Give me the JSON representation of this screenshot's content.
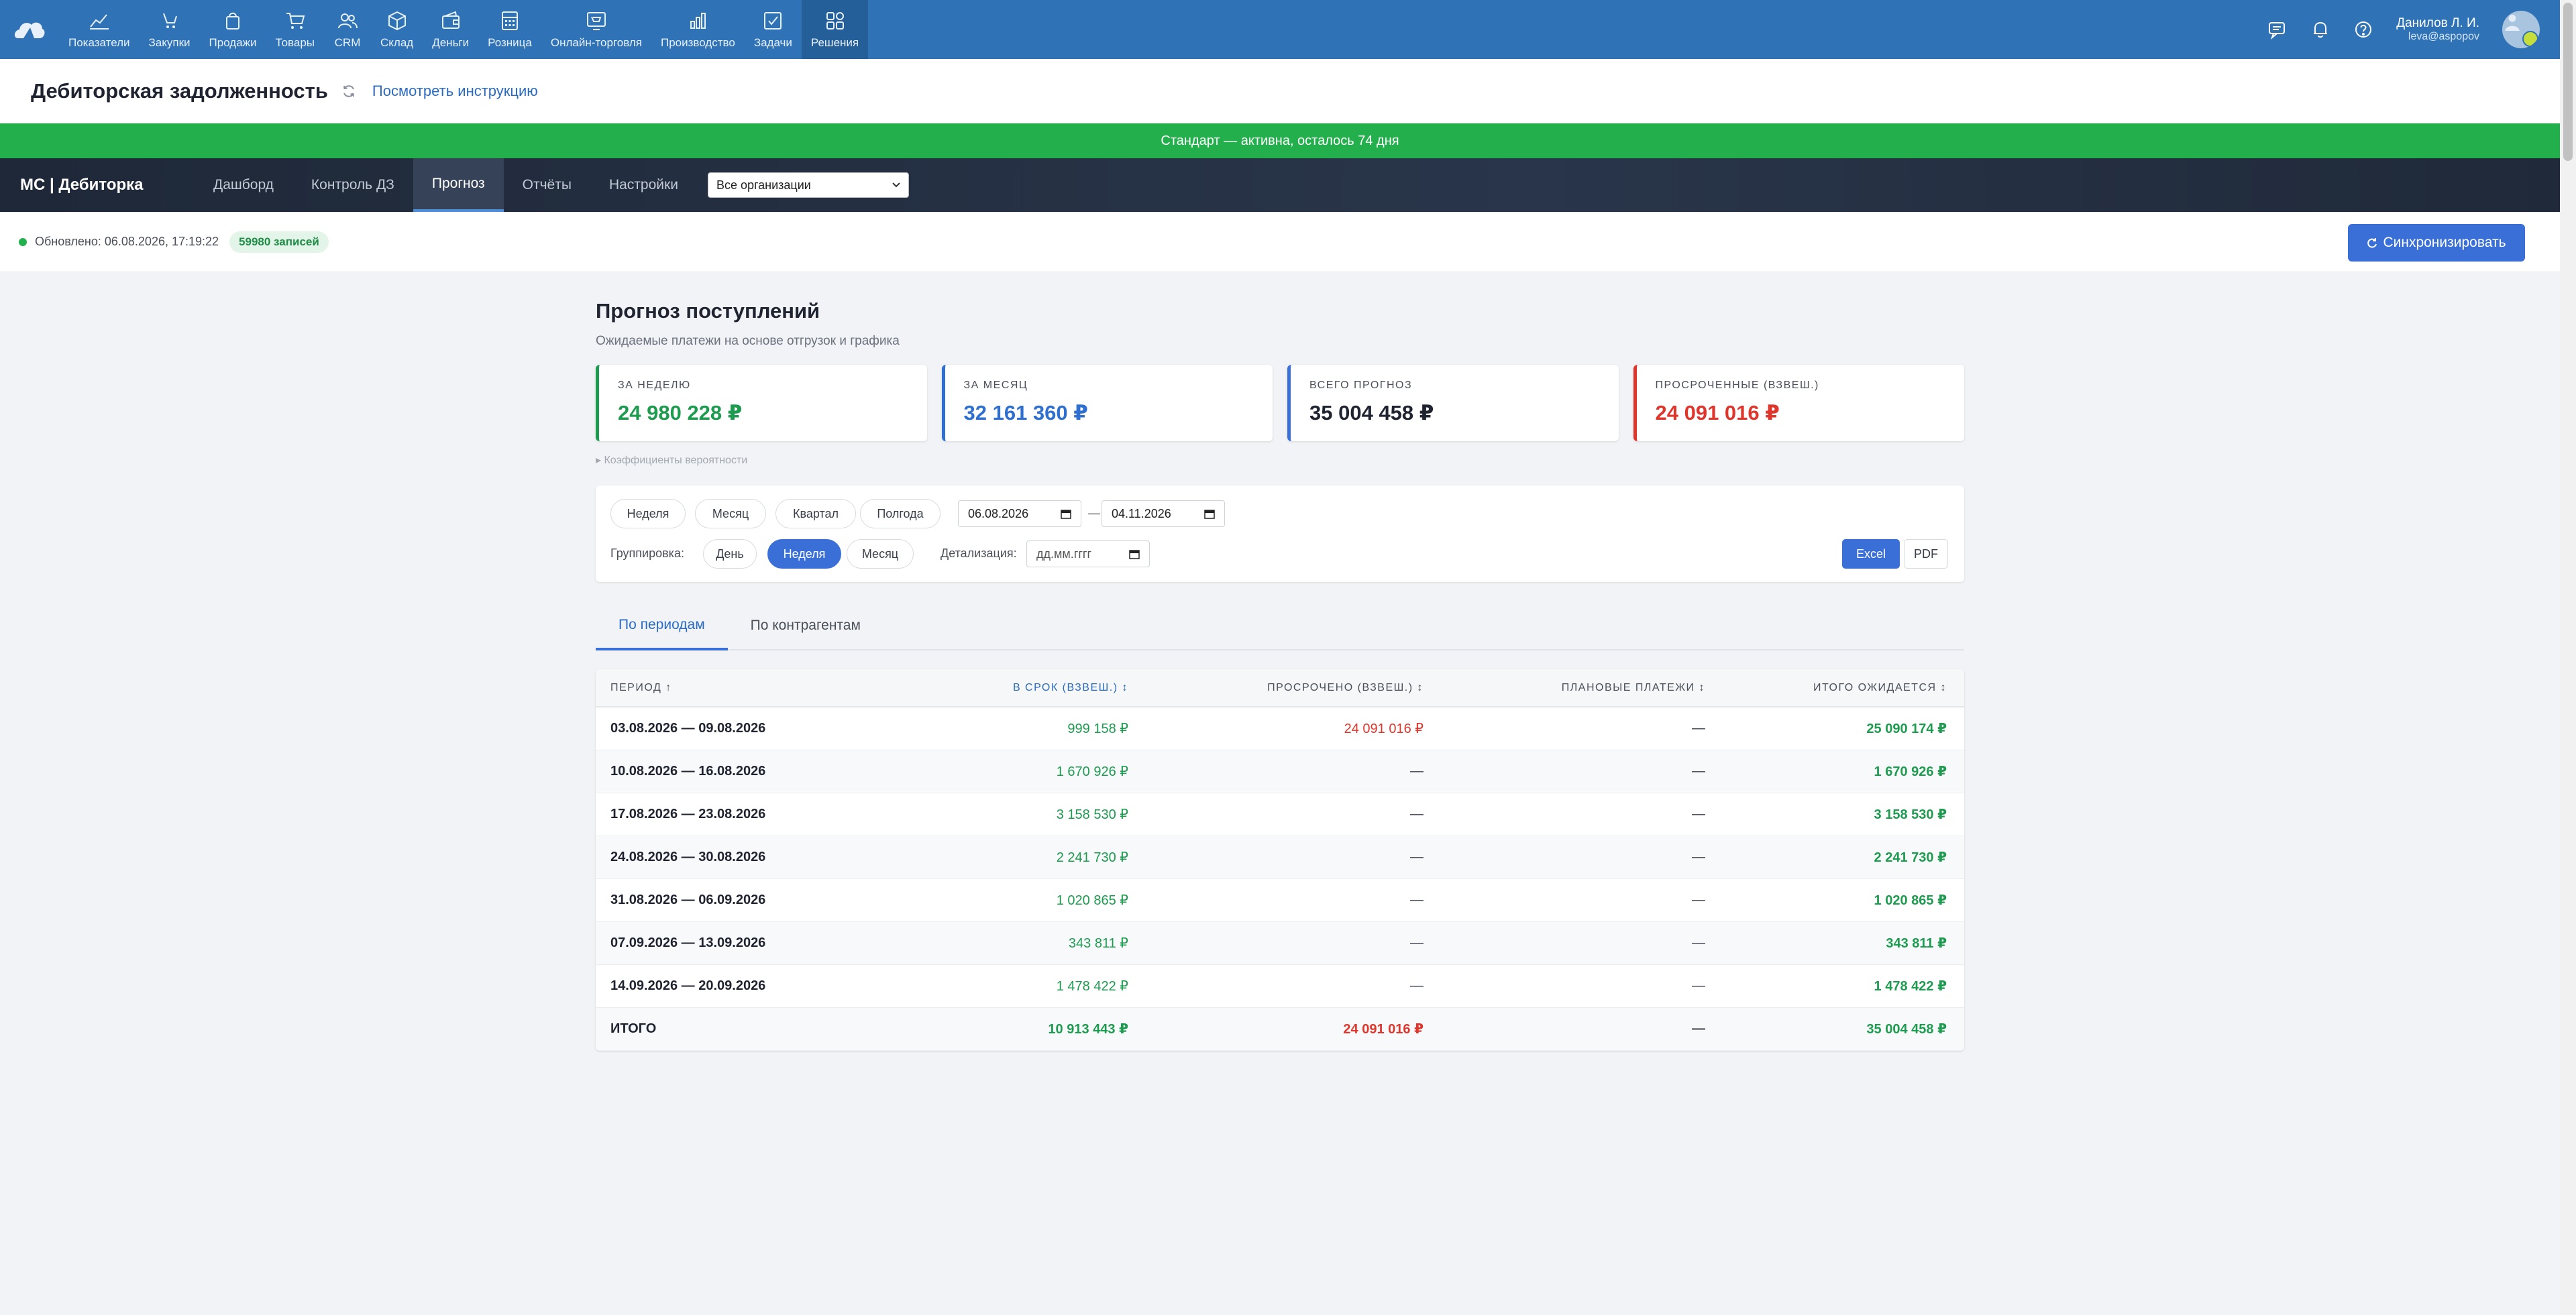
{
  "nav": {
    "items": [
      {
        "label": "Показатели",
        "icon": "chart-line-icon"
      },
      {
        "label": "Закупки",
        "icon": "purchase-icon"
      },
      {
        "label": "Продажи",
        "icon": "bag-icon"
      },
      {
        "label": "Товары",
        "icon": "cart-icon"
      },
      {
        "label": "CRM",
        "icon": "people-icon"
      },
      {
        "label": "Склад",
        "icon": "box-icon"
      },
      {
        "label": "Деньги",
        "icon": "wallet-icon"
      },
      {
        "label": "Розница",
        "icon": "register-icon"
      },
      {
        "label": "Онлайн-торговля",
        "icon": "online-store-icon"
      },
      {
        "label": "Производство",
        "icon": "bar-chart-icon"
      },
      {
        "label": "Задачи",
        "icon": "task-check-icon"
      },
      {
        "label": "Решения",
        "icon": "grid-icon"
      }
    ],
    "user_name": "Данилов Л. И.",
    "user_email": "leva@aspopov"
  },
  "page": {
    "title": "Дебиторская задолженность",
    "instruction_link": "Посмотреть инструкцию"
  },
  "banner": {
    "text": "Стандарт — активна, осталось 74 дня"
  },
  "subnav": {
    "brand": "МС | Дебиторка",
    "tabs": [
      "Дашборд",
      "Контроль ДЗ",
      "Прогноз",
      "Отчёты",
      "Настройки"
    ],
    "active_tab": "Прогноз",
    "org_select": "Все организации"
  },
  "status": {
    "updated": "Обновлено: 06.08.2026, 17:19:22",
    "records": "59980 записей",
    "sync_button": "Синхронизировать"
  },
  "forecast": {
    "title": "Прогноз поступлений",
    "subtitle": "Ожидаемые платежи на основе отгрузок и графика",
    "cards": [
      {
        "label": "ЗА НЕДЕЛЮ",
        "value": "24 980 228 ₽",
        "color": "#1d9b4f"
      },
      {
        "label": "ЗА МЕСЯЦ",
        "value": "32 161 360 ₽",
        "color": "#2e6fd0"
      },
      {
        "label": "ВСЕГО ПРОГНОЗ",
        "value": "35 004 458 ₽",
        "color": "#1f2430"
      },
      {
        "label": "ПРОСРОЧЕННЫЕ (ВЗВЕШ.)",
        "value": "24 091 016 ₽",
        "color": "#e0352b"
      }
    ],
    "coef_link": "▸ Коэффициенты вероятности"
  },
  "filters": {
    "periods": [
      "Неделя",
      "Месяц",
      "Квартал",
      "Полгода"
    ],
    "date_from": "06.08.2026",
    "date_sep": "—",
    "date_to": "04.11.2026",
    "grouping_label": "Группировка:",
    "groupings": [
      "День",
      "Неделя",
      "Месяц"
    ],
    "grouping_active": "Неделя",
    "detail_label": "Детализация:",
    "detail_placeholder": "дд.мм.гггг",
    "excel": "Excel",
    "pdf": "PDF"
  },
  "table_tabs": [
    "По периодам",
    "По контрагентам"
  ],
  "table": {
    "headers": [
      "ПЕРИОД ↑",
      "В СРОК (ВЗВЕШ.) ↕",
      "ПРОСРОЧЕНО (ВЗВЕШ.) ↕",
      "ПЛАНОВЫЕ ПЛАТЕЖИ ↕",
      "ИТОГО ОЖИДАЕТСЯ ↕"
    ],
    "rows": [
      [
        "03.08.2026 — 09.08.2026",
        "999 158 ₽",
        "24 091 016 ₽",
        "—",
        "25 090 174 ₽"
      ],
      [
        "10.08.2026 — 16.08.2026",
        "1 670 926 ₽",
        "—",
        "—",
        "1 670 926 ₽"
      ],
      [
        "17.08.2026 — 23.08.2026",
        "3 158 530 ₽",
        "—",
        "—",
        "3 158 530 ₽"
      ],
      [
        "24.08.2026 — 30.08.2026",
        "2 241 730 ₽",
        "—",
        "—",
        "2 241 730 ₽"
      ],
      [
        "31.08.2026 — 06.09.2026",
        "1 020 865 ₽",
        "—",
        "—",
        "1 020 865 ₽"
      ],
      [
        "07.09.2026 — 13.09.2026",
        "343 811 ₽",
        "—",
        "—",
        "343 811 ₽"
      ],
      [
        "14.09.2026 — 20.09.2026",
        "1 478 422 ₽",
        "—",
        "—",
        "1 478 422 ₽"
      ]
    ],
    "total": [
      "ИТОГО",
      "10 913 443 ₽",
      "24 091 016 ₽",
      "—",
      "35 004 458 ₽"
    ]
  }
}
